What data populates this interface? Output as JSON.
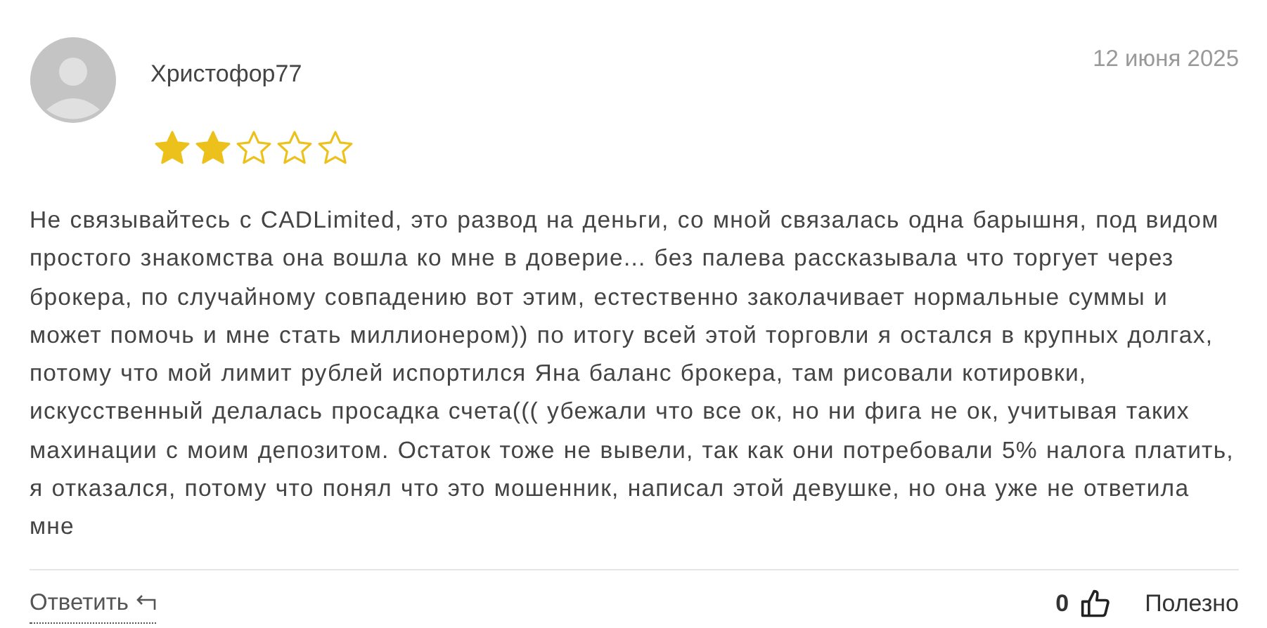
{
  "review": {
    "author": "Христофор77",
    "date": "12 июня 2025",
    "stars": 2,
    "text": "Не связывайтесь с CADLimited, это развод на деньги, со мной связалась одна барышня, под видом простого знакомства она вошла ко мне в доверие... без палева рассказывала что торгует через брокера, по случайному совпадению вот этим, естественно заколачивает нормальные суммы и может помочь и мне стать миллионером)) по итогу всей этой торговли я остался в крупных долгах, потому что мой лимит рублей испортился Яна баланс брокера, там рисовали котировки, искусственный делалась просадка счета((( убежали что все ок, но ни фига не ок, учитывая таких махинации с моим депозитом. Остаток тоже не вывели, так как они потребовали 5% налога платить, я отказался, потому что понял что это мошенник, написал этой девушке, но она уже не ответила мне",
    "reply_label": "Ответить",
    "likes": "0",
    "helpful_label": "Полезно"
  }
}
